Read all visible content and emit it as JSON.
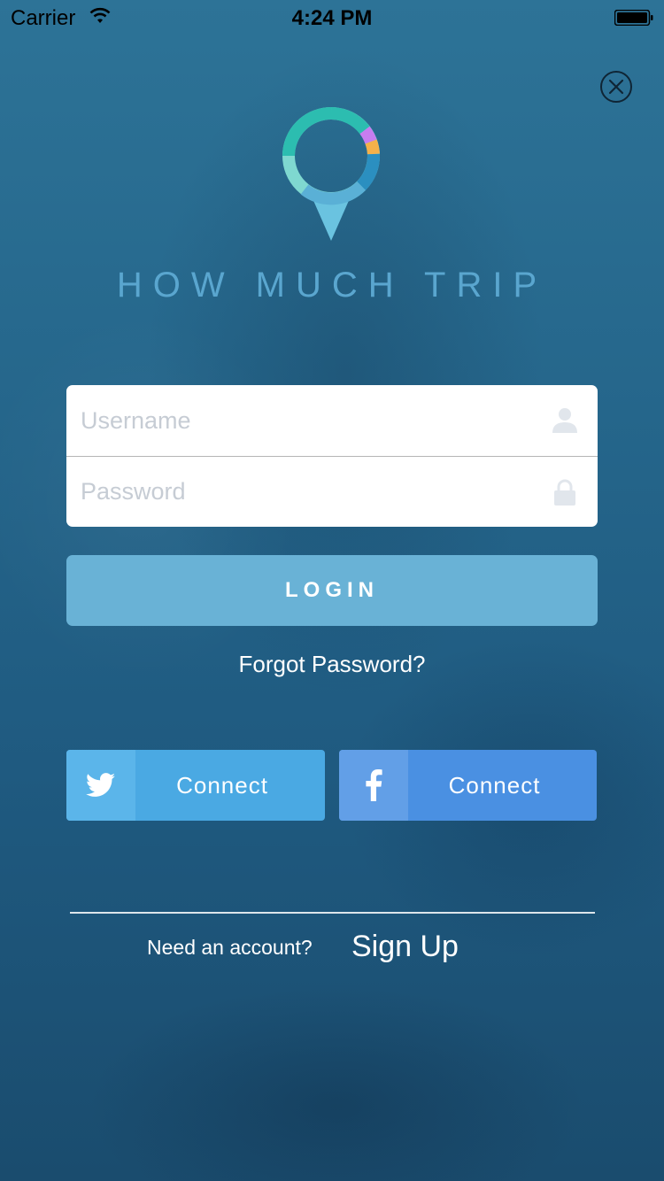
{
  "status_bar": {
    "carrier": "Carrier",
    "time": "4:24 PM",
    "wifi_icon": "wifi-icon",
    "battery_icon": "battery-icon"
  },
  "header": {
    "close_icon": "close-circle-icon",
    "logo_icon": "map-pin-ring-logo",
    "brand_name": "HOW MUCH TRIP"
  },
  "login_form": {
    "username_placeholder": "Username",
    "username_value": "",
    "username_icon": "user-icon",
    "password_placeholder": "Password",
    "password_value": "",
    "password_icon": "lock-icon",
    "login_label": "LOGIN",
    "forgot_label": "Forgot Password?"
  },
  "social": {
    "twitter": {
      "icon": "twitter-icon",
      "label": "Connect"
    },
    "facebook": {
      "icon": "facebook-icon",
      "label": "Connect"
    }
  },
  "footer": {
    "prompt": "Need an account?",
    "signup_label": "Sign Up"
  },
  "colors": {
    "background_top": "#2d7397",
    "background_bottom": "#1a4c6e",
    "brand_text": "#5aa6cf",
    "login_button": "#69b2d6",
    "twitter": "#4aa9e3",
    "facebook": "#4a90e2",
    "logo_teal": "#2cbdb0",
    "logo_blue": "#2b8fc0",
    "logo_purple": "#c77df0",
    "logo_orange": "#f5b14a",
    "logo_mint": "#7fd8d0"
  }
}
